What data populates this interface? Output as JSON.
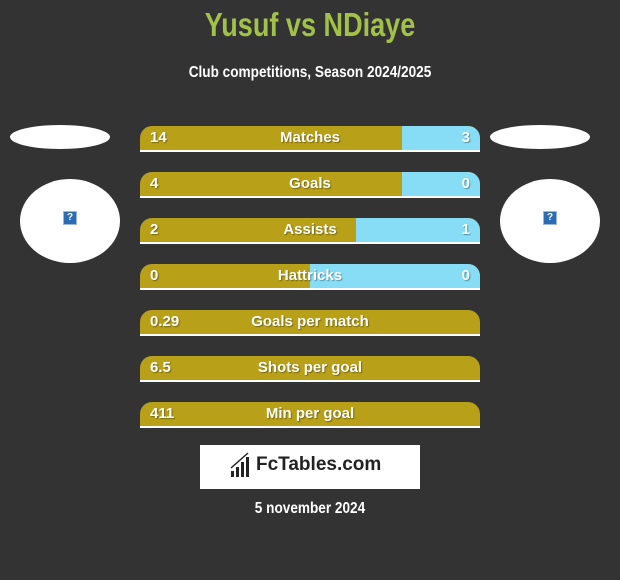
{
  "header": {
    "title": "Yusuf vs NDiaye",
    "subtitle": "Club competitions, Season 2024/2025"
  },
  "players": {
    "left": {
      "name": "Yusuf",
      "image_icon": "missing-image-icon"
    },
    "right": {
      "name": "NDiaye",
      "image_icon": "missing-image-icon"
    }
  },
  "colors": {
    "left": "#b8a018",
    "right": "#87ddf5",
    "title": "#a2c14a",
    "background": "#333333"
  },
  "chart_data": {
    "type": "bar",
    "title": "Yusuf vs NDiaye",
    "subtitle": "Club competitions, Season 2024/2025",
    "categories": [
      "Matches",
      "Goals",
      "Assists",
      "Hattricks",
      "Goals per match",
      "Shots per goal",
      "Min per goal"
    ],
    "series": [
      {
        "name": "Yusuf",
        "values": [
          14,
          4,
          2,
          0,
          0.29,
          6.5,
          411
        ]
      },
      {
        "name": "NDiaye",
        "values": [
          3,
          0,
          1,
          0,
          null,
          null,
          null
        ]
      }
    ],
    "rows": [
      {
        "label": "Matches",
        "left": "14",
        "right": "3",
        "right_share": 0.23
      },
      {
        "label": "Goals",
        "left": "4",
        "right": "0",
        "right_share": 0.23
      },
      {
        "label": "Assists",
        "left": "2",
        "right": "1",
        "right_share": 0.365
      },
      {
        "label": "Hattricks",
        "left": "0",
        "right": "0",
        "right_share": 0.5
      },
      {
        "label": "Goals per match",
        "left": "0.29",
        "right": "",
        "right_share": 0
      },
      {
        "label": "Shots per goal",
        "left": "6.5",
        "right": "",
        "right_share": 0
      },
      {
        "label": "Min per goal",
        "left": "411",
        "right": "",
        "right_share": 0
      }
    ]
  },
  "footer": {
    "logo_text": "FcTables.com",
    "date": "5 november 2024"
  }
}
